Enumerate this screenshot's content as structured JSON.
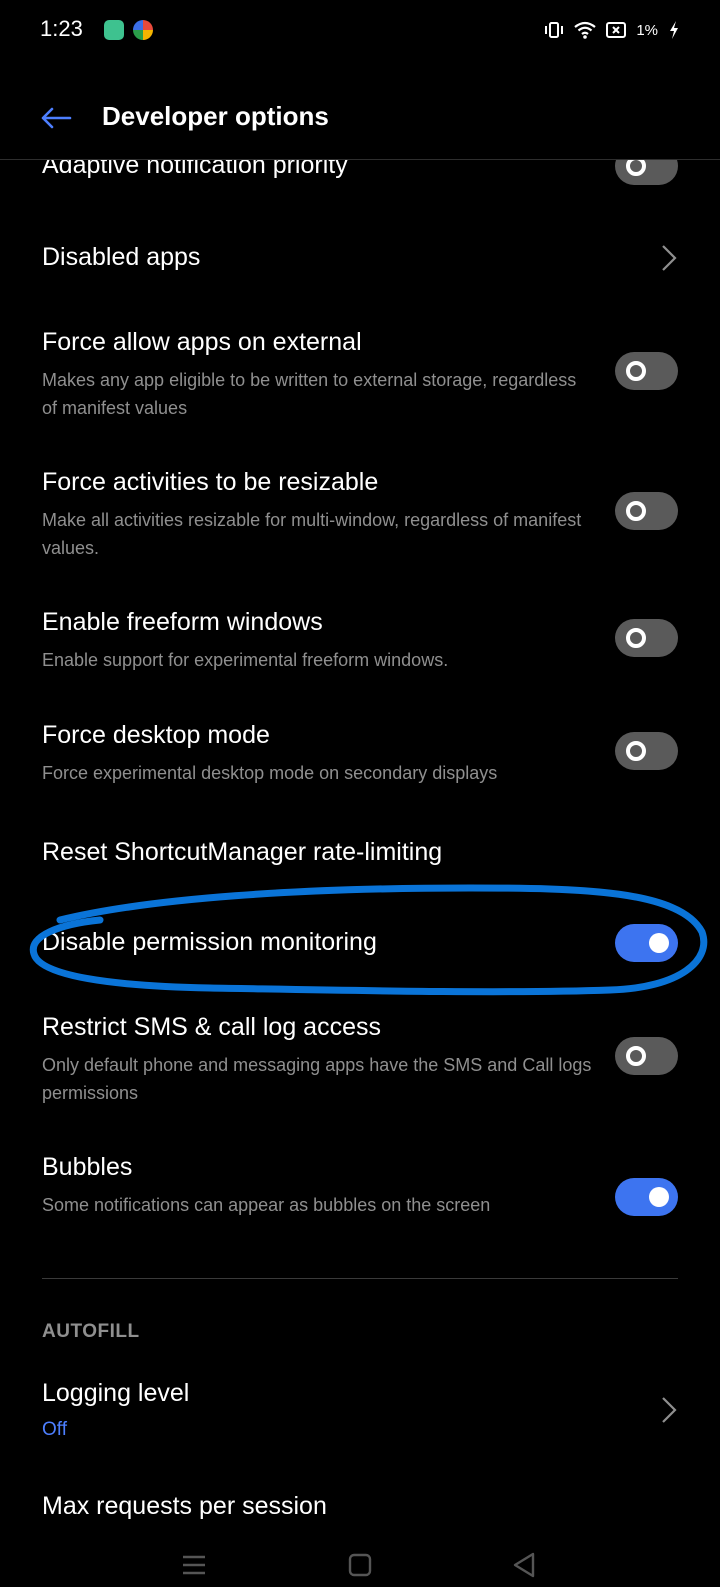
{
  "status_bar": {
    "time": "1:23",
    "battery": "1%",
    "icons": [
      "app-icon-green",
      "app-icon-colorful",
      "vibrate-icon",
      "wifi-icon",
      "battery-icon",
      "charging-icon"
    ]
  },
  "header": {
    "title": "Developer options",
    "back_icon": "back-arrow-icon",
    "accent": "#4d7fff"
  },
  "rows": [
    {
      "title": "Adaptive notification priority",
      "control": "toggle",
      "state": "off"
    },
    {
      "title": "Disabled apps",
      "control": "chevron"
    },
    {
      "title": "Force allow apps on external",
      "subtitle": "Makes any app eligible to be written to external storage, regardless of manifest values",
      "control": "toggle",
      "state": "off"
    },
    {
      "title": "Force activities to be resizable",
      "subtitle": "Make all activities resizable for multi-window, regardless of manifest values.",
      "control": "toggle",
      "state": "off"
    },
    {
      "title": "Enable freeform windows",
      "subtitle": "Enable support for experimental freeform windows.",
      "control": "toggle",
      "state": "off"
    },
    {
      "title": "Force desktop mode",
      "subtitle": "Force experimental desktop mode on secondary displays",
      "control": "toggle",
      "state": "off"
    },
    {
      "title": "Reset ShortcutManager rate-limiting",
      "control": "none"
    },
    {
      "title": "Disable permission monitoring",
      "control": "toggle",
      "state": "on"
    },
    {
      "title": "Restrict SMS & call log access",
      "subtitle": "Only default phone and messaging apps have the SMS and Call logs permissions",
      "control": "toggle",
      "state": "off"
    },
    {
      "title": "Bubbles",
      "subtitle": "Some notifications can appear as bubbles on the screen",
      "control": "toggle",
      "state": "on"
    }
  ],
  "autofill": {
    "section_title": "AUTOFILL",
    "logging_level": {
      "title": "Logging level",
      "value": "Off"
    },
    "max_requests": {
      "title": "Max requests per session"
    }
  },
  "colors": {
    "background": "#000000",
    "toggle_on": "#3d74f0",
    "toggle_off": "#5a5a5a",
    "highlight_annotation": "#0a74d8"
  },
  "nav_bar": [
    "menu-icon",
    "home-icon",
    "back-triangle-icon"
  ]
}
